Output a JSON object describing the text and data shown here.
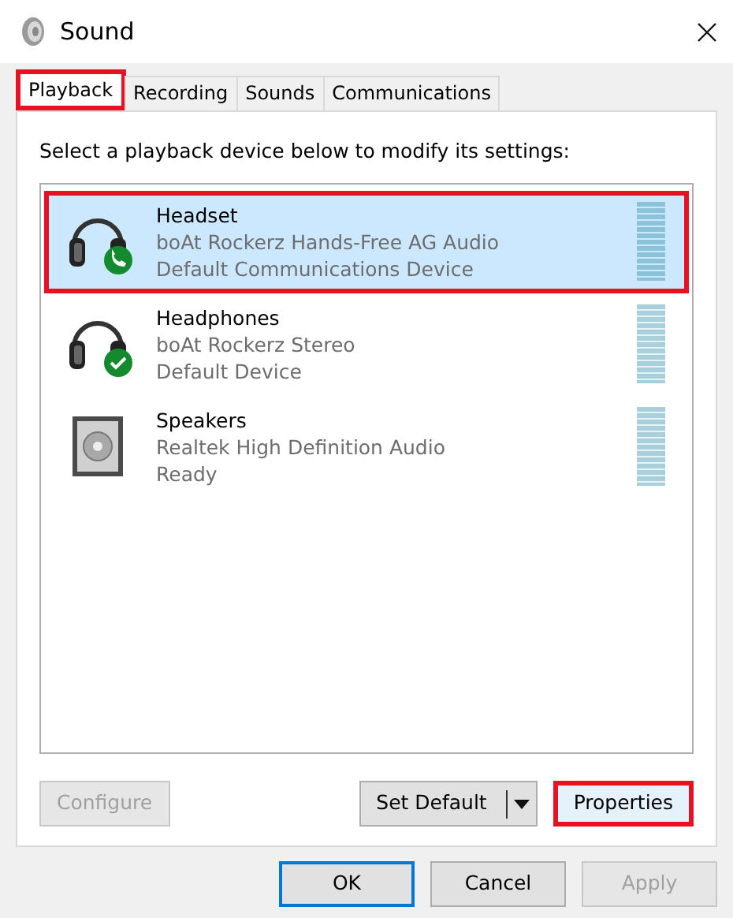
{
  "window": {
    "title": "Sound"
  },
  "tabs": [
    {
      "label": "Playback",
      "selected": true,
      "highlighted": true
    },
    {
      "label": "Recording",
      "selected": false,
      "highlighted": false
    },
    {
      "label": "Sounds",
      "selected": false,
      "highlighted": false
    },
    {
      "label": "Communications",
      "selected": false,
      "highlighted": false
    }
  ],
  "instruction": "Select a playback device below to modify its settings:",
  "devices": [
    {
      "name": "Headset",
      "description": "boAt Rockerz Hands-Free AG Audio",
      "status": "Default Communications Device",
      "kind": "headset",
      "default_communications": true,
      "default_device": false,
      "selected": true,
      "highlighted": true
    },
    {
      "name": "Headphones",
      "description": "boAt Rockerz Stereo",
      "status": "Default Device",
      "kind": "headset",
      "default_communications": false,
      "default_device": true,
      "selected": false,
      "highlighted": false
    },
    {
      "name": "Speakers",
      "description": "Realtek High Definition Audio",
      "status": "Ready",
      "kind": "speaker",
      "default_communications": false,
      "default_device": false,
      "selected": false,
      "highlighted": false
    }
  ],
  "panel_buttons": [
    {
      "label": "Configure",
      "kind": "plain",
      "disabled": true,
      "highlighted": false
    },
    {
      "label": "Set Default",
      "kind": "split",
      "disabled": false,
      "highlighted": false
    },
    {
      "label": "Properties",
      "kind": "plain",
      "disabled": false,
      "highlighted": true
    }
  ],
  "dialog_buttons": [
    {
      "label": "OK",
      "default": true,
      "disabled": false
    },
    {
      "label": "Cancel",
      "default": false,
      "disabled": false
    },
    {
      "label": "Apply",
      "default": false,
      "disabled": true
    }
  ]
}
